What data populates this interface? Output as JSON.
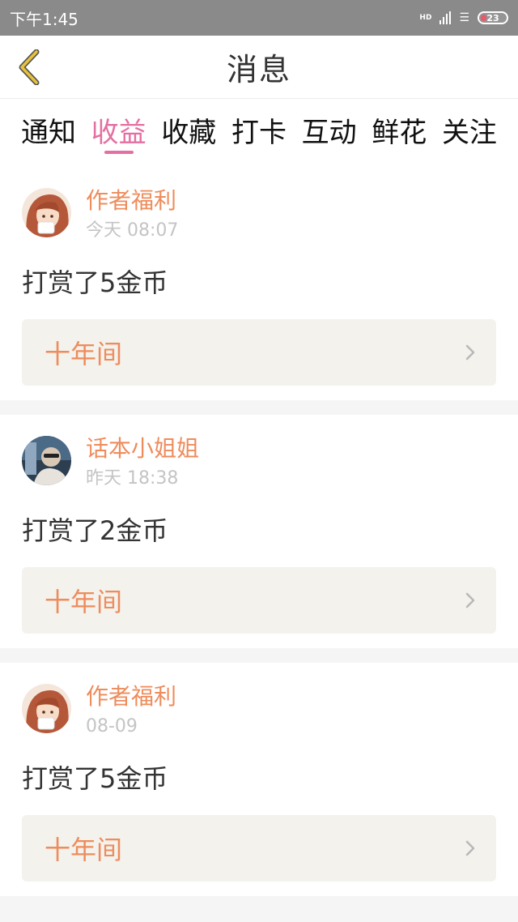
{
  "status_bar": {
    "time": "下午1:45",
    "network_label": "HD",
    "battery_level": "23"
  },
  "nav": {
    "title": "消息"
  },
  "tabs": [
    {
      "label": "通知",
      "active": false
    },
    {
      "label": "收益",
      "active": true
    },
    {
      "label": "收藏",
      "active": false
    },
    {
      "label": "打卡",
      "active": false
    },
    {
      "label": "互动",
      "active": false
    },
    {
      "label": "鲜花",
      "active": false
    },
    {
      "label": "关注",
      "active": false
    }
  ],
  "messages": [
    {
      "sender": "作者福利",
      "time": "今天 08:07",
      "text": "打赏了5金币",
      "book_title": "十年间",
      "avatar_icon": "anime-girl-avatar"
    },
    {
      "sender": "话本小姐姐",
      "time": "昨天 18:38",
      "text": "打赏了2金币",
      "book_title": "十年间",
      "avatar_icon": "person-photo-avatar"
    },
    {
      "sender": "作者福利",
      "time": "08-09",
      "text": "打赏了5金币",
      "book_title": "十年间",
      "avatar_icon": "anime-girl-avatar"
    }
  ],
  "colors": {
    "accent_pink": "#e46fa2",
    "sender_orange": "#ee8c5c",
    "back_arrow_yellow": "#e8c23a"
  }
}
